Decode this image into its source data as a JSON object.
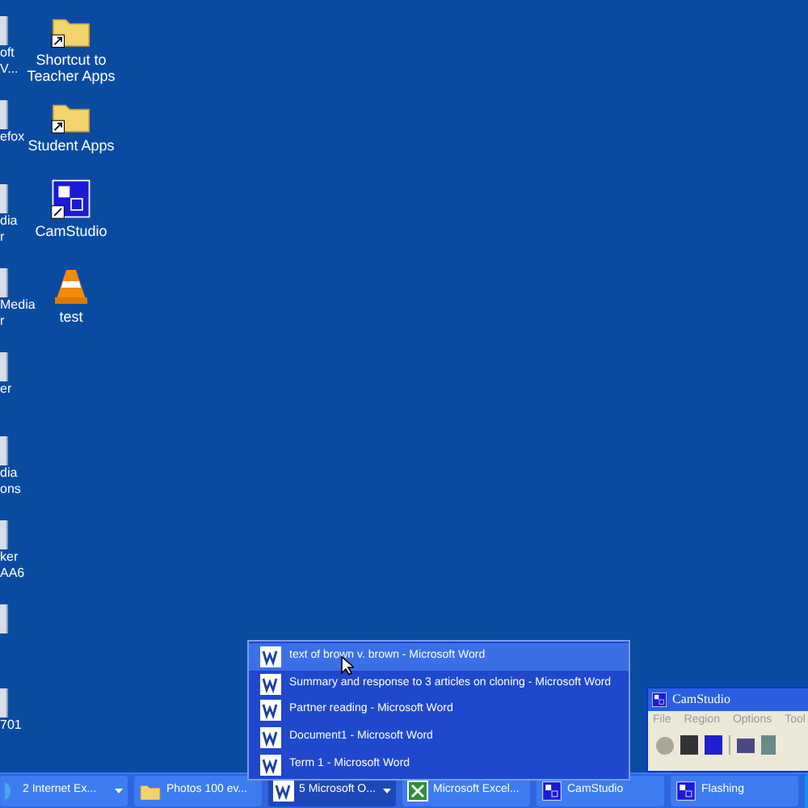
{
  "desktop_icons_left": [
    {
      "kind": "partial",
      "lines": [
        "oft",
        "V..."
      ]
    },
    {
      "kind": "partial",
      "lines": [
        "efox"
      ]
    },
    {
      "kind": "partial",
      "lines": [
        "dia",
        "r"
      ]
    },
    {
      "kind": "partial",
      "lines": [
        "Media",
        "r"
      ]
    },
    {
      "kind": "partial",
      "lines": [
        "er"
      ]
    },
    {
      "kind": "partial",
      "lines": [
        "dia",
        "ons"
      ]
    },
    {
      "kind": "partial",
      "lines": [
        "ker",
        "AA6"
      ]
    },
    {
      "kind": "partial"
    },
    {
      "kind": "partial",
      "lines": [
        "701"
      ]
    }
  ],
  "desktop_icons": [
    {
      "kind": "folder",
      "label": "Shortcut to Teacher Apps",
      "shortcut": true
    },
    {
      "kind": "folder",
      "label": "Student Apps",
      "shortcut": true
    },
    {
      "kind": "camstudio",
      "label": "CamStudio",
      "shortcut": true
    },
    {
      "kind": "cone",
      "label": "test",
      "shortcut": false
    }
  ],
  "group_menu": {
    "items": [
      {
        "label": "text of brown v. brown - Microsoft Word",
        "selected": true
      },
      {
        "label": "Summary and response to 3 articles on cloning - Microsoft Word",
        "selected": false
      },
      {
        "label": "Partner reading - Microsoft Word",
        "selected": false
      },
      {
        "label": "Document1 - Microsoft Word",
        "selected": false
      },
      {
        "label": "Term 1 - Microsoft Word",
        "selected": false
      }
    ]
  },
  "camstudio_window": {
    "title": "CamStudio",
    "menu": [
      "File",
      "Region",
      "Options",
      "Tool"
    ]
  },
  "taskbar": {
    "buttons": [
      {
        "kind": "ie",
        "label": "2 Internet Ex...",
        "group": true,
        "selected": false
      },
      {
        "kind": "folder",
        "label": "Photos 100 ev...",
        "group": false,
        "selected": false
      },
      {
        "kind": "word",
        "label": "5 Microsoft O...",
        "group": true,
        "selected": true
      },
      {
        "kind": "excel",
        "label": "Microsoft Excel...",
        "group": false,
        "selected": false
      },
      {
        "kind": "camstudio",
        "label": "CamStudio",
        "group": false,
        "selected": false
      },
      {
        "kind": "camstudio",
        "label": "Flashing",
        "group": false,
        "selected": false
      }
    ]
  }
}
